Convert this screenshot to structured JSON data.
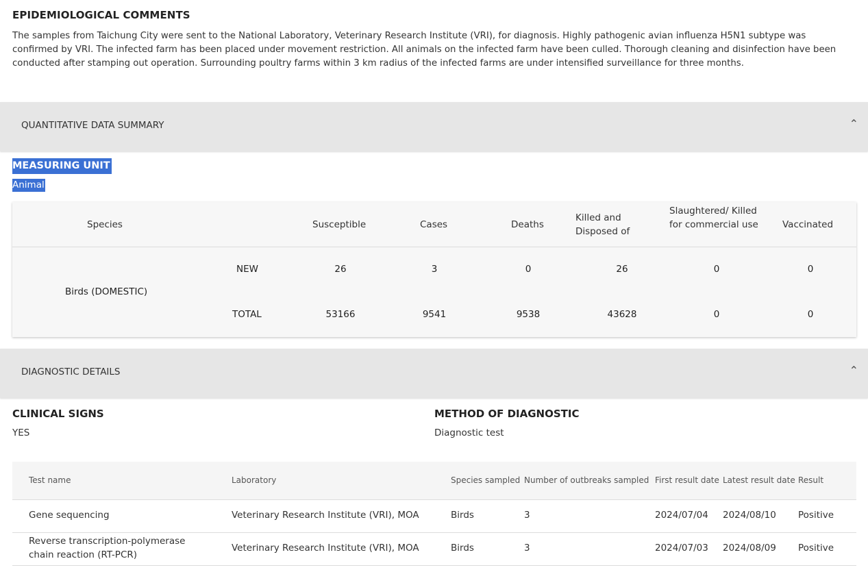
{
  "epidemiological": {
    "title": "EPIDEMIOLOGICAL COMMENTS",
    "text": "The samples from Taichung City were sent to the National Laboratory, Veterinary Research Institute (VRI), for diagnosis. Highly pathogenic avian influenza H5N1 subtype was confirmed by VRI. The infected farm has been placed under movement restriction. All animals on the infected farm have been culled. Thorough cleaning and disinfection have been conducted after stamping out operation. Surrounding poultry farms within 3 km radius of the infected farms are under intensified surveillance for three months."
  },
  "quantitative": {
    "section_label": "QUANTITATIVE DATA SUMMARY",
    "chevron": "chevron-up-icon",
    "measuring_unit_label": "MEASURING UNIT",
    "measuring_unit_value": "Animal",
    "headers": {
      "species": "Species",
      "susceptible": "Susceptible",
      "cases": "Cases",
      "deaths": "Deaths",
      "killed": "Killed and Disposed of",
      "slaughtered": "Slaughtered/ Killed for commercial use",
      "vaccinated": "Vaccinated"
    },
    "species": "Birds (DOMESTIC)",
    "rows": [
      {
        "type": "NEW",
        "susceptible": "26",
        "cases": "3",
        "deaths": "0",
        "killed": "26",
        "slaughtered": "0",
        "vaccinated": "0"
      },
      {
        "type": "TOTAL",
        "susceptible": "53166",
        "cases": "9541",
        "deaths": "9538",
        "killed": "43628",
        "slaughtered": "0",
        "vaccinated": "0"
      }
    ]
  },
  "diagnostic": {
    "section_label": "DIAGNOSTIC DETAILS",
    "chevron": "chevron-up-icon",
    "clinical_signs_label": "CLINICAL SIGNS",
    "clinical_signs_value": "YES",
    "method_label": "METHOD OF DIAGNOSTIC",
    "method_value": "Diagnostic test",
    "columns": [
      "Test name",
      "Laboratory",
      "Species sampled",
      "Number of outbreaks sampled",
      "First result date",
      "Latest result date",
      "Result"
    ],
    "rows": [
      {
        "test": "Gene sequencing",
        "lab": "Veterinary Research Institute (VRI), MOA",
        "species": "Birds",
        "outbreaks": "3",
        "first": "2024/07/04",
        "latest": "2024/08/10",
        "result": "Positive"
      },
      {
        "test": "Reverse transcription-polymerase chain reaction (RT-PCR)",
        "lab": "Veterinary Research Institute (VRI), MOA",
        "species": "Birds",
        "outbreaks": "3",
        "first": "2024/07/03",
        "latest": "2024/08/09",
        "result": "Positive"
      }
    ]
  }
}
